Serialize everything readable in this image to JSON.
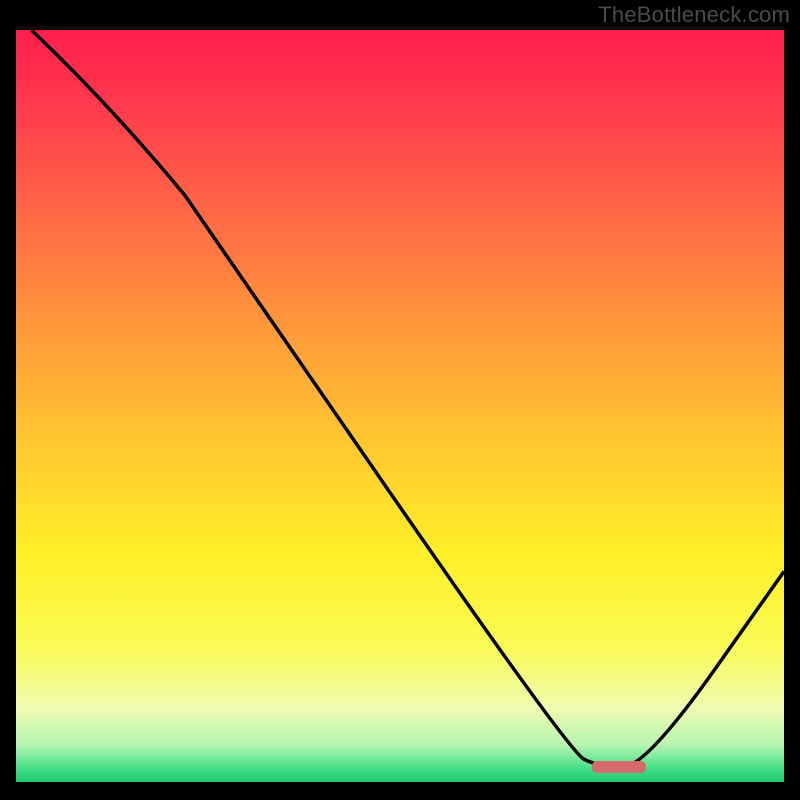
{
  "watermark": "TheBottleneck.com",
  "chart_data": {
    "type": "line",
    "title": "",
    "xlabel": "",
    "ylabel": "",
    "xlim": [
      0,
      100
    ],
    "ylim": [
      0,
      100
    ],
    "marker": {
      "x_start": 75,
      "x_end": 82,
      "y": 2,
      "color": "#d46a6a"
    },
    "curve": [
      {
        "x": 2,
        "y": 100
      },
      {
        "x": 22,
        "y": 78
      },
      {
        "x": 72,
        "y": 4
      },
      {
        "x": 76,
        "y": 2
      },
      {
        "x": 82,
        "y": 2
      },
      {
        "x": 100,
        "y": 28
      }
    ],
    "gradient_stops": [
      {
        "offset": 0.0,
        "color": "#ff1e4b"
      },
      {
        "offset": 0.1,
        "color": "#ff3a4d"
      },
      {
        "offset": 0.25,
        "color": "#ff6a45"
      },
      {
        "offset": 0.4,
        "color": "#ff9a3a"
      },
      {
        "offset": 0.55,
        "color": "#ffc830"
      },
      {
        "offset": 0.7,
        "color": "#fff028"
      },
      {
        "offset": 0.82,
        "color": "#f9fb55"
      },
      {
        "offset": 0.9,
        "color": "#f0fcaf"
      },
      {
        "offset": 0.95,
        "color": "#b8f5b0"
      },
      {
        "offset": 0.98,
        "color": "#4de08a"
      },
      {
        "offset": 1.0,
        "color": "#18c96a"
      }
    ],
    "border_color": "#000000",
    "curve_color": "#000000"
  }
}
